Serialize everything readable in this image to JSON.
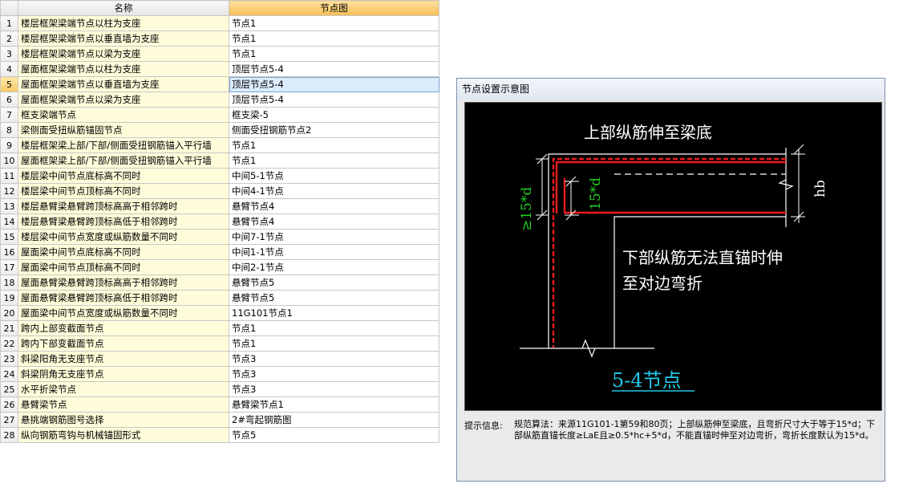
{
  "table": {
    "headers": {
      "name": "名称",
      "node": "节点图"
    },
    "selected_row": 5,
    "rows": [
      {
        "idx": "1",
        "name": "楼层框架梁端节点以柱为支座",
        "node": "节点1"
      },
      {
        "idx": "2",
        "name": "楼层框架梁端节点以垂直墙为支座",
        "node": "节点1"
      },
      {
        "idx": "3",
        "name": "楼层框架梁端节点以梁为支座",
        "node": "节点1"
      },
      {
        "idx": "4",
        "name": "屋面框架梁端节点以柱为支座",
        "node": "顶层节点5-4"
      },
      {
        "idx": "5",
        "name": "屋面框架梁端节点以垂直墙为支座",
        "node": "顶层节点5-4"
      },
      {
        "idx": "6",
        "name": "屋面框架梁端节点以梁为支座",
        "node": "顶层节点5-4"
      },
      {
        "idx": "7",
        "name": "框支梁端节点",
        "node": "框支梁-5"
      },
      {
        "idx": "8",
        "name": "梁侧面受扭纵筋锚固节点",
        "node": "侧面受扭钢筋节点2"
      },
      {
        "idx": "9",
        "name": "楼层框架梁上部/下部/侧面受扭钢筋锚入平行墙",
        "node": "节点1"
      },
      {
        "idx": "10",
        "name": "屋面框架梁上部/下部/侧面受扭钢筋锚入平行墙",
        "node": "节点1"
      },
      {
        "idx": "11",
        "name": "楼层梁中间节点底标高不同时",
        "node": "中间5-1节点"
      },
      {
        "idx": "12",
        "name": "楼层梁中间节点顶标高不同时",
        "node": "中间4-1节点"
      },
      {
        "idx": "13",
        "name": "楼层悬臂梁悬臂跨顶标高高于相邻跨时",
        "node": "悬臂节点4"
      },
      {
        "idx": "14",
        "name": "楼层悬臂梁悬臂跨顶标高低于相邻跨时",
        "node": "悬臂节点4"
      },
      {
        "idx": "15",
        "name": "楼层梁中间节点宽度或纵筋数量不同时",
        "node": "中间7-1节点"
      },
      {
        "idx": "16",
        "name": "屋面梁中间节点底标高不同时",
        "node": "中间1-1节点"
      },
      {
        "idx": "17",
        "name": "屋面梁中间节点顶标高不同时",
        "node": "中间2-1节点"
      },
      {
        "idx": "18",
        "name": "屋面悬臂梁悬臂跨顶标高高于相邻跨时",
        "node": "悬臂节点5"
      },
      {
        "idx": "19",
        "name": "屋面悬臂梁悬臂跨顶标高低于相邻跨时",
        "node": "悬臂节点5"
      },
      {
        "idx": "20",
        "name": "屋面梁中间节点宽度或纵筋数量不同时",
        "node": "11G101节点1"
      },
      {
        "idx": "21",
        "name": "跨内上部变截面节点",
        "node": "节点1"
      },
      {
        "idx": "22",
        "name": "跨内下部变截面节点",
        "node": "节点1"
      },
      {
        "idx": "23",
        "name": "斜梁阳角无支座节点",
        "node": "节点3"
      },
      {
        "idx": "24",
        "name": "斜梁阴角无支座节点",
        "node": "节点3"
      },
      {
        "idx": "25",
        "name": "水平折梁节点",
        "node": "节点3"
      },
      {
        "idx": "26",
        "name": "悬臂梁节点",
        "node": "悬臂梁节点1"
      },
      {
        "idx": "27",
        "name": "悬挑端钢筋图号选择",
        "node": "2#弯起钢筋图"
      },
      {
        "idx": "28",
        "name": "纵向钢筋弯钩与机械锚固形式",
        "node": "节点5"
      }
    ]
  },
  "dialog": {
    "title": "节点设置示意图",
    "diagram": {
      "top_label": "上部纵筋伸至梁底",
      "bottom_label_1": "下部纵筋无法直锚时伸",
      "bottom_label_2": "至对边弯折",
      "dim_outer": "≥15*d",
      "dim_inner": "15*d",
      "dim_hb": "hb",
      "node_name": "5-4节点"
    },
    "hint_label": "提示信息:",
    "hint_text": "规范算法：来源11G101-1第59和80页；上部纵筋伸至梁底，且弯折尺寸大于等于15*d；下部纵筋直锚长度≥LaE且≥0.5*hc+5*d，不能直锚时伸至对边弯折，弯折长度默认为15*d。",
    "colors": {
      "red": "#e81c1c",
      "green": "#22d022",
      "cyan": "#22c8e8",
      "white": "#ffffff"
    }
  }
}
